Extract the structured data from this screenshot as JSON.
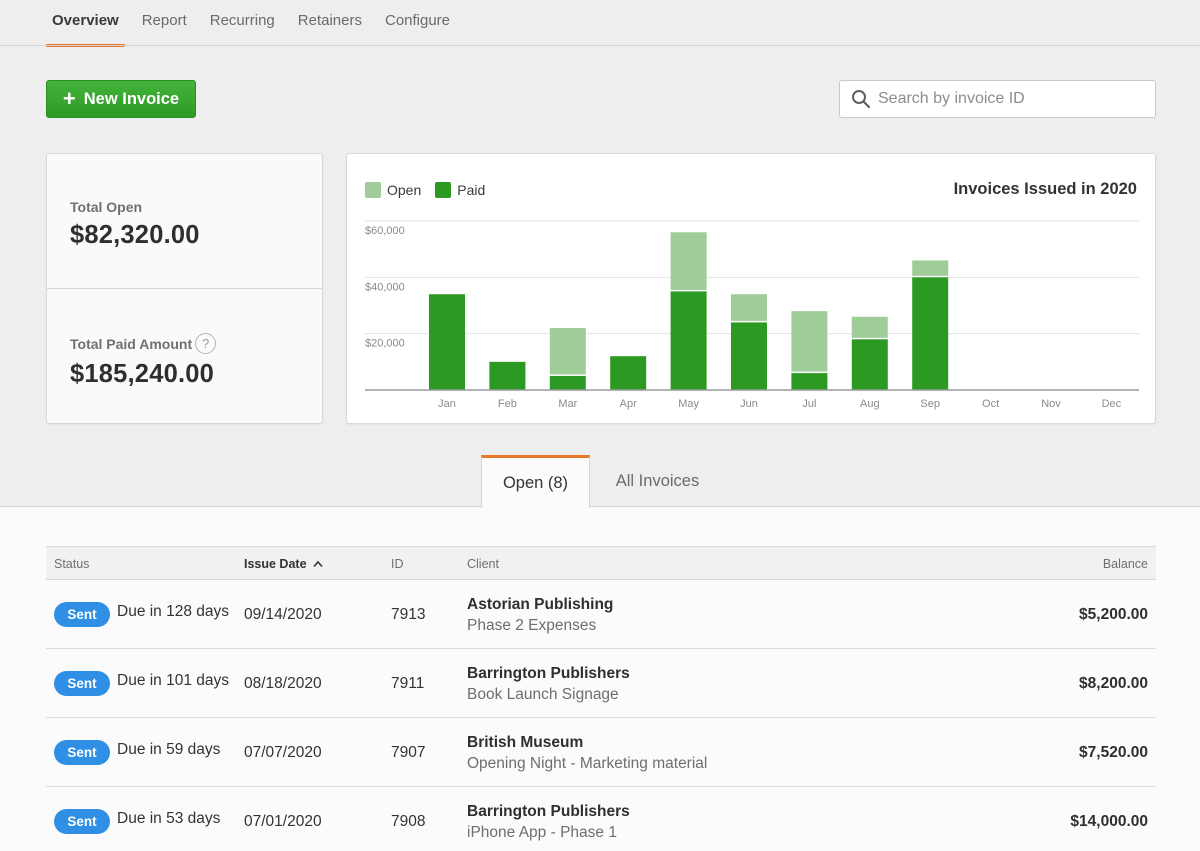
{
  "nav": {
    "items": [
      {
        "label": "Overview",
        "active": true
      },
      {
        "label": "Report",
        "active": false
      },
      {
        "label": "Recurring",
        "active": false
      },
      {
        "label": "Retainers",
        "active": false
      },
      {
        "label": "Configure",
        "active": false
      }
    ]
  },
  "toolbar": {
    "new_invoice_label": "New Invoice",
    "new_invoice_icon": "plus-icon",
    "search_placeholder": "Search by invoice ID",
    "search_value": "",
    "search_icon": "search-icon"
  },
  "totals": {
    "open_label": "Total Open",
    "open_value": "$82,320.00",
    "paid_label": "Total Paid Amount",
    "paid_value": "$185,240.00",
    "help_glyph": "?"
  },
  "colors": {
    "accent_orange": "#e8782a",
    "paid_green": "#2c9a22",
    "open_green": "#9fcd97",
    "button_green": "#3aaa31",
    "sent_blue": "#2f8fe5"
  },
  "chart_data": {
    "type": "bar",
    "stacked": true,
    "title": "Invoices Issued in 2020",
    "xlabel": "",
    "ylabel": "",
    "categories": [
      "Jan",
      "Feb",
      "Mar",
      "Apr",
      "May",
      "Jun",
      "Jul",
      "Aug",
      "Sep",
      "Oct",
      "Nov",
      "Dec"
    ],
    "series": [
      {
        "name": "Paid",
        "color": "#2c9a22",
        "values": [
          34000,
          10000,
          5000,
          12000,
          35000,
          24000,
          6000,
          18000,
          40000,
          0,
          0,
          0
        ]
      },
      {
        "name": "Open",
        "color": "#9fcd97",
        "values": [
          0,
          0,
          17000,
          0,
          21000,
          10000,
          22000,
          8000,
          6000,
          0,
          0,
          0
        ]
      }
    ],
    "legend": [
      {
        "name": "Open",
        "color": "#9fcd97"
      },
      {
        "name": "Paid",
        "color": "#2c9a22"
      }
    ],
    "legend_position": "top-left",
    "yticks": [
      20000,
      40000,
      60000
    ],
    "ytick_labels": [
      "$20,000",
      "$40,000",
      "$60,000"
    ],
    "ylim": [
      0,
      60000
    ],
    "grid": true
  },
  "tabs": [
    {
      "label": "Open (8)",
      "active": true
    },
    {
      "label": "All Invoices",
      "active": false
    }
  ],
  "table": {
    "columns": [
      {
        "label": "Status"
      },
      {
        "label": "Issue Date",
        "sorted": "asc"
      },
      {
        "label": "ID"
      },
      {
        "label": "Client"
      },
      {
        "label": "Balance"
      }
    ],
    "sort_icon": "chevron-up-icon",
    "rows": [
      {
        "status": "Sent",
        "due": "Due in 128 days",
        "date": "09/14/2020",
        "id": "7913",
        "client": "Astorian Publishing",
        "description": "Phase 2 Expenses",
        "balance": "$5,200.00"
      },
      {
        "status": "Sent",
        "due": "Due in 101 days",
        "date": "08/18/2020",
        "id": "7911",
        "client": "Barrington Publishers",
        "description": "Book Launch Signage",
        "balance": "$8,200.00"
      },
      {
        "status": "Sent",
        "due": "Due in 59 days",
        "date": "07/07/2020",
        "id": "7907",
        "client": "British Museum",
        "description": "Opening Night - Marketing material",
        "balance": "$7,520.00"
      },
      {
        "status": "Sent",
        "due": "Due in 53 days",
        "date": "07/01/2020",
        "id": "7908",
        "client": "Barrington Publishers",
        "description": "iPhone App - Phase 1",
        "balance": "$14,000.00"
      }
    ]
  }
}
